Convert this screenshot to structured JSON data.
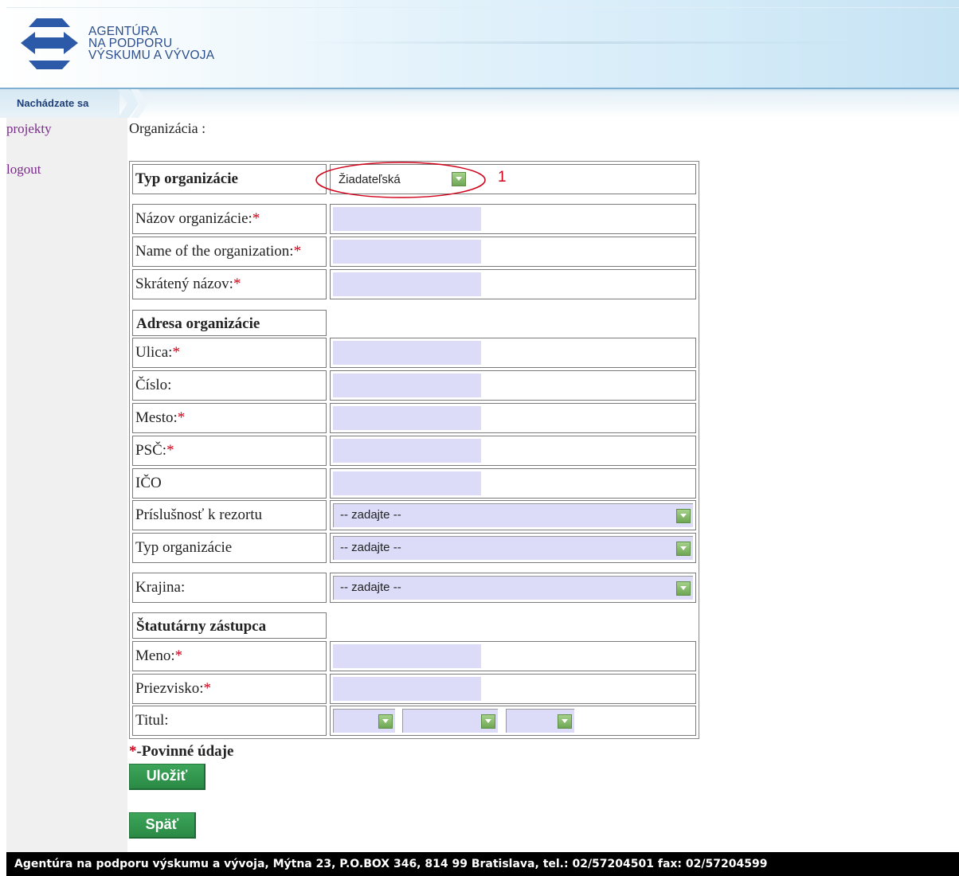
{
  "header": {
    "logo_line1": "AGENTÚRA",
    "logo_line2": "NA PODPORU",
    "logo_line3": "VÝSKUMU A VÝVOJA"
  },
  "breadcrumb": {
    "label": "Nachádzate sa"
  },
  "sidebar": {
    "items": [
      {
        "label": "projekty"
      },
      {
        "label": "logout"
      }
    ]
  },
  "page": {
    "title": "Organizácia :"
  },
  "form": {
    "org_type": {
      "label": "Typ organizácie",
      "value": "Žiadateľská",
      "annotation": "1"
    },
    "fields_top": [
      {
        "label": "Názov organizácie:",
        "req": "*"
      },
      {
        "label": "Name of the organization:",
        "req": "*"
      },
      {
        "label": "Skrátený názov:",
        "req": "*"
      }
    ],
    "address_section": "Adresa organizácie",
    "address_fields": [
      {
        "label": "Ulica:",
        "req": "*"
      },
      {
        "label": "Číslo:"
      },
      {
        "label": "Mesto:",
        "req": "*"
      },
      {
        "label": "PSČ:",
        "req": "*"
      },
      {
        "label": "IČO"
      }
    ],
    "selects": [
      {
        "label": "Príslušnosť k rezortu",
        "value": "-- zadajte --"
      },
      {
        "label": "Typ organizácie",
        "value": "-- zadajte --"
      },
      {
        "label": "Krajina:",
        "value": "-- zadajte --"
      }
    ],
    "rep_section": "Štatutárny zástupca",
    "rep_fields": [
      {
        "label": "Meno:",
        "req": "*"
      },
      {
        "label": "Priezvisko:",
        "req": "*"
      }
    ],
    "title_field": {
      "label": "Titul:"
    }
  },
  "footnote": {
    "star": "*",
    "text": "-Povinné údaje"
  },
  "buttons": {
    "save": "Uložiť",
    "back": "Späť"
  },
  "footer": {
    "text": "Agentúra na podporu výskumu a vývoja, Mýtna 23, P.O.BOX 346, 814 99 Bratislava, tel.: 02/57204501 fax: 02/57204599"
  },
  "colors": {
    "input_bg": "#dcdcf8",
    "button_green": "#2e8b45",
    "link_purple": "#7a2a8a",
    "required_red": "#d0021b"
  }
}
